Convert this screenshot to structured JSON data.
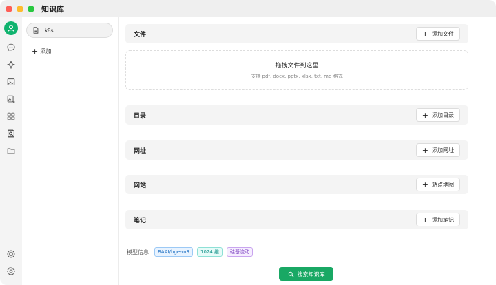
{
  "app": {
    "title": "知识库"
  },
  "rail": {
    "icons": [
      "avatar-icon",
      "chat-icon",
      "sparkle-icon",
      "image-icon",
      "image-edit-icon",
      "apps-icon",
      "knowledge-icon",
      "folder-icon",
      "sun-icon",
      "settings-icon"
    ],
    "accent": "#10b36e"
  },
  "kb_list": {
    "items": [
      {
        "label": "k8s"
      }
    ],
    "add_label": "添加"
  },
  "sections": {
    "file": {
      "title": "文件",
      "button": "添加文件"
    },
    "dir": {
      "title": "目录",
      "button": "添加目录"
    },
    "url": {
      "title": "网址",
      "button": "添加网址"
    },
    "site": {
      "title": "网站",
      "button": "站点地图"
    },
    "note": {
      "title": "笔记",
      "button": "添加笔记"
    }
  },
  "dropzone": {
    "title": "拖拽文件到这里",
    "hint": "支持 pdf, docx, pptx, xlsx, txt, md 格式"
  },
  "model_info": {
    "label": "模型信息",
    "model": "BAAI/bge-m3",
    "dims": "1024 维",
    "provider": "硅基流动"
  },
  "search_button": {
    "label": "搜索知识库",
    "color": "#19a864"
  }
}
